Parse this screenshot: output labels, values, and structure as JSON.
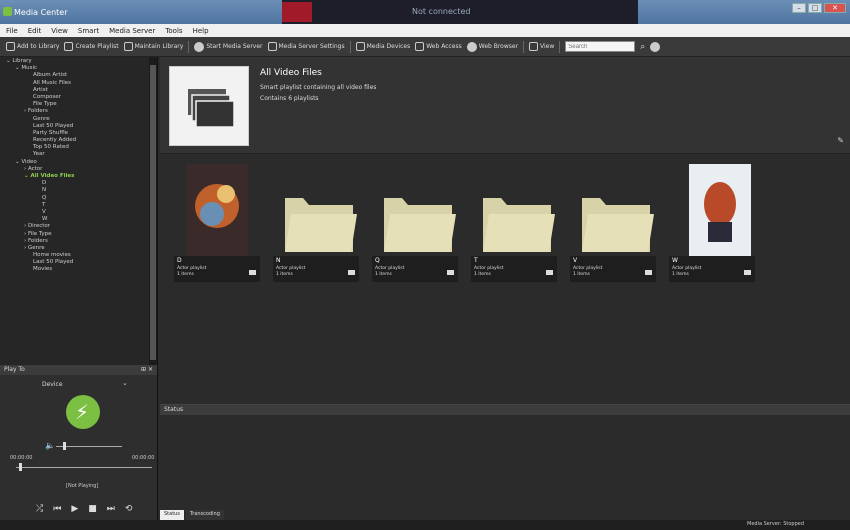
{
  "window": {
    "title": "Media Center"
  },
  "menu": [
    "File",
    "Edit",
    "View",
    "Smart",
    "Media Server",
    "Tools",
    "Help"
  ],
  "media_strip": {
    "now": "Not connected"
  },
  "toolbar": {
    "buttons": [
      {
        "label": "Add to Library"
      },
      {
        "label": "Create Playlist"
      },
      {
        "label": "Maintain Library"
      },
      {
        "label": "Start Media Server"
      },
      {
        "label": "Media Server Settings"
      },
      {
        "label": "Media Devices"
      },
      {
        "label": "Web Access"
      },
      {
        "label": "Web Browser"
      },
      {
        "label": "View"
      }
    ],
    "search_placeholder": "Search"
  },
  "sidebar": {
    "items": [
      {
        "label": "⌄ Library",
        "indent": 0
      },
      {
        "label": "⌄ Music",
        "indent": 1
      },
      {
        "label": "Album Artist",
        "indent": 3
      },
      {
        "label": "All Music Files",
        "indent": 3
      },
      {
        "label": "Artist",
        "indent": 3
      },
      {
        "label": "Composer",
        "indent": 3
      },
      {
        "label": "File Type",
        "indent": 3
      },
      {
        "label": "› Folders",
        "indent": 2
      },
      {
        "label": "Genre",
        "indent": 3
      },
      {
        "label": "Last 50 Played",
        "indent": 3
      },
      {
        "label": "Party Shuffle",
        "indent": 3
      },
      {
        "label": "Recently Added",
        "indent": 3
      },
      {
        "label": "Top 50 Rated",
        "indent": 3
      },
      {
        "label": "Year",
        "indent": 3
      },
      {
        "label": "⌄ Video",
        "indent": 1
      },
      {
        "label": "› Actor",
        "indent": 2
      },
      {
        "label": "⌄ All Video Files",
        "indent": 2,
        "active": true
      },
      {
        "label": "D",
        "indent": 4
      },
      {
        "label": "N",
        "indent": 4
      },
      {
        "label": "Q",
        "indent": 4
      },
      {
        "label": "T",
        "indent": 4
      },
      {
        "label": "V",
        "indent": 4
      },
      {
        "label": "W",
        "indent": 4
      },
      {
        "label": "› Director",
        "indent": 2
      },
      {
        "label": "› File Type",
        "indent": 2
      },
      {
        "label": "› Folders",
        "indent": 2
      },
      {
        "label": "› Genre",
        "indent": 2
      },
      {
        "label": "Home movies",
        "indent": 3
      },
      {
        "label": "Last 50 Played",
        "indent": 3
      },
      {
        "label": "Movies",
        "indent": 3
      }
    ]
  },
  "playto": {
    "title": "Play To",
    "controls": "⊞ ✕",
    "device": "Device",
    "time_start": "00:00:00",
    "time_end": "00:00:00",
    "not_playing": "[Not Playing]",
    "volume_level": 0.1,
    "seek_level": 0.02
  },
  "header": {
    "title": "All Video Files",
    "description": "Smart playlist containing all video files",
    "count": "Contains 6 playlists"
  },
  "tiles": [
    {
      "letter": "D",
      "type": "Actor playlist",
      "count": "1 items",
      "art": "poster-fire"
    },
    {
      "letter": "N",
      "type": "Actor playlist",
      "count": "1 items",
      "art": "folder"
    },
    {
      "letter": "Q",
      "type": "Actor playlist",
      "count": "1 items",
      "art": "folder"
    },
    {
      "letter": "T",
      "type": "Actor playlist",
      "count": "1 items",
      "art": "folder"
    },
    {
      "letter": "V",
      "type": "Actor playlist",
      "count": "1 items",
      "art": "folder"
    },
    {
      "letter": "W",
      "type": "Actor playlist",
      "count": "1 items",
      "art": "poster-face"
    }
  ],
  "status_panel": {
    "title": "Status"
  },
  "bottom_tabs": [
    "Status",
    "Transcoding"
  ],
  "statusbar": {
    "server": "Media Server: Stopped"
  },
  "colors": {
    "accent": "#7bc043",
    "folder": "#d8d2a8"
  }
}
